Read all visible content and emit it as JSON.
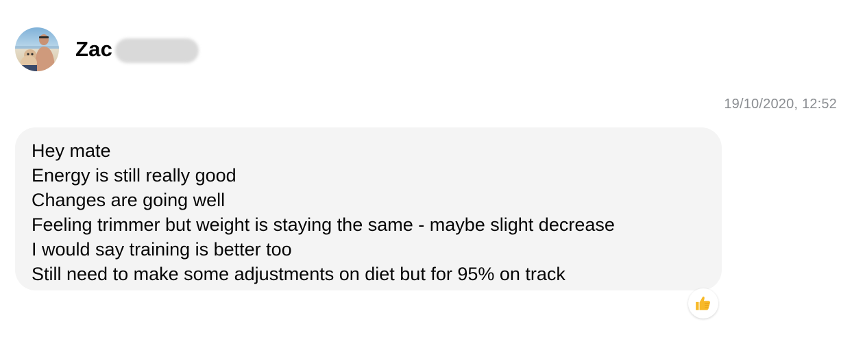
{
  "sender": {
    "name": "Zac",
    "avatar_icon": "profile-photo"
  },
  "message": {
    "timestamp": "19/10/2020, 12:52",
    "lines": [
      "Hey mate",
      "Energy is still really good",
      "Changes are going well",
      "Feeling trimmer but weight is staying the same - maybe slight decrease",
      "I would say training is better too",
      "Still need to make some adjustments on diet but for 95% on track"
    ],
    "bubble_color": "#f4f4f4",
    "reaction": {
      "icon": "thumbs-up-icon",
      "color": "#f7b928"
    }
  },
  "colors": {
    "text": "#050505",
    "timestamp": "#8a8d91",
    "redaction": "#d9d9d9"
  }
}
